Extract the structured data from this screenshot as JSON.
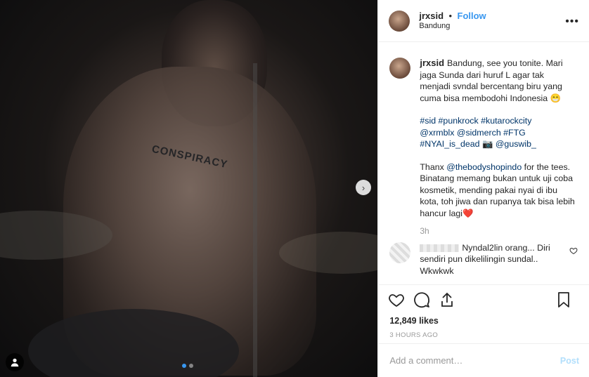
{
  "post": {
    "username": "jrxsid",
    "separator": "•",
    "follow_label": "Follow",
    "location": "Bandung",
    "more_icon": "•••"
  },
  "caption": {
    "username": "jrxsid",
    "line1": "Bandung, see you tonite. Mari jaga Sunda dari huruf L agar tak menjadi svndal bercentang biru yang cuma bisa membodohi Indonesia 😁",
    "tags_line1": "#sid #punkrock #kutarockcity",
    "tags_line2": "@xrmblx @sidmerch #FTG",
    "tags_line3": "#NYAI_is_dead 📷 @guswib_",
    "thanx_prefix": "Thanx ",
    "thanx_mention": "@thebodyshopindo",
    "thanx_rest": " for the tees. Binatang memang bukan untuk uji coba kosmetik, mending pakai nyai di ibu kota, toh jiwa dan rupanya tak bisa lebih hancur lagi❤️",
    "time": "3h"
  },
  "comment": {
    "text": "Nyndal2lin orang... Diri sendiri pun dikelilingin sundal.. Wkwkwk"
  },
  "stats": {
    "likes": "12,849 likes",
    "ago": "3 HOURS AGO"
  },
  "add_comment": {
    "placeholder": "Add a comment…",
    "post_label": "Post"
  },
  "photo": {
    "tattoo_text": "CONSPIRACY",
    "carousel_index": 1,
    "carousel_count": 2
  },
  "colors": {
    "accent": "#3897f0",
    "post_disabled": "#b2dffc",
    "link": "#003569",
    "muted": "#999999"
  }
}
